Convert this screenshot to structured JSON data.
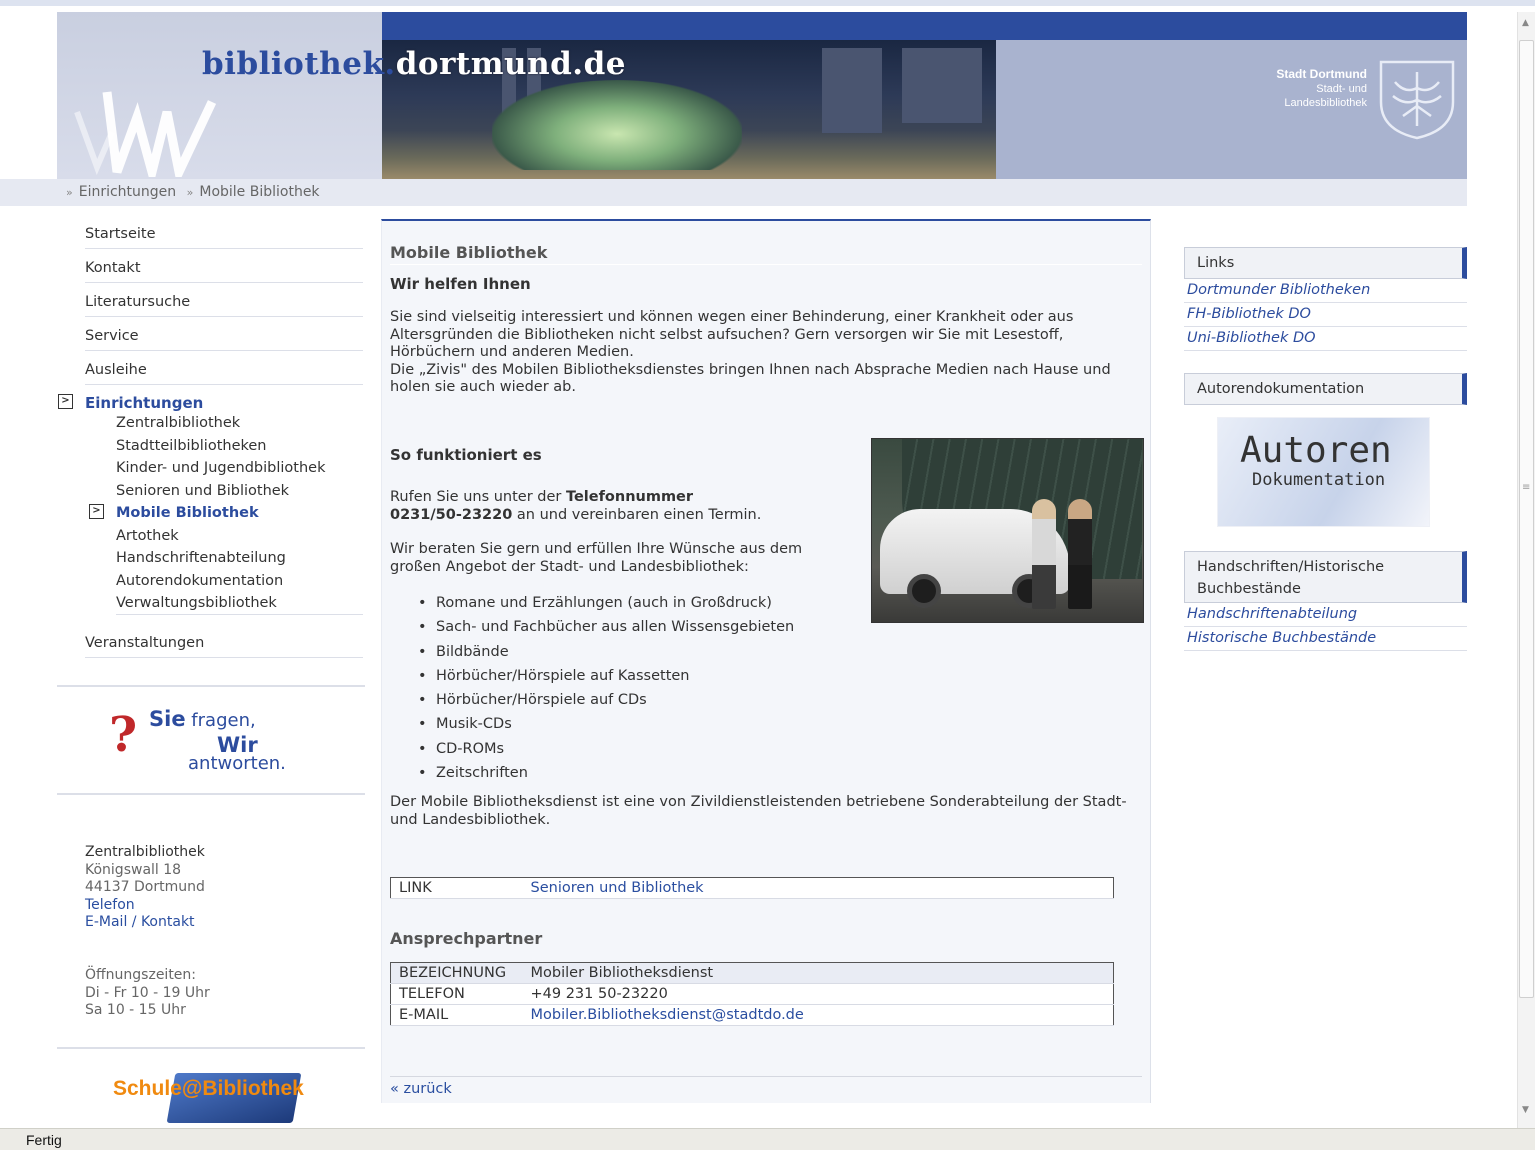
{
  "header": {
    "site_title_blue": "bibliothek.",
    "site_title_white": "dortmund.de",
    "stadt_line1": "Stadt Dortmund",
    "stadt_line2": "Stadt- und",
    "stadt_line3": "Landesbibliothek"
  },
  "breadcrumb": [
    "Einrichtungen",
    "Mobile Bibliothek"
  ],
  "nav": {
    "items": [
      "Startseite",
      "Kontakt",
      "Literatursuche",
      "Service",
      "Ausleihe"
    ],
    "active_section": "Einrichtungen",
    "sub_items": [
      "Zentralbibliothek",
      "Stadtteilbibliotheken",
      "Kinder- und Jugendbibliothek",
      "Senioren und Bibliothek"
    ],
    "active_sub": "Mobile Bibliothek",
    "sub_items_after": [
      "Artothek",
      "Handschriftenabteilung",
      "Autorendokumentation",
      "Verwaltungsbibliothek"
    ],
    "after": "Veranstaltungen"
  },
  "faq": {
    "q": "?",
    "sie": "Sie",
    "fragen": " fragen,",
    "wir": "Wir",
    "antworten": "antworten."
  },
  "address": {
    "name": "Zentralbibliothek",
    "street": "Königswall 18",
    "city": "44137 Dortmund",
    "phone_link": "Telefon",
    "mail_link": "E-Mail / Kontakt"
  },
  "hours": {
    "label": "Öffnungszeiten:",
    "line1": "Di - Fr 10 - 19 Uhr",
    "line2": "Sa 10 - 15 Uhr"
  },
  "school_logo": "Schule@Bibliothek",
  "main": {
    "title": "Mobile Bibliothek",
    "subtitle": "Wir helfen Ihnen",
    "intro1": "Sie sind vielseitig interessiert und können wegen einer Behinderung, einer Krankheit oder aus Altersgründen die Bibliotheken nicht selbst aufsuchen? Gern versorgen wir Sie mit Lesestoff, Hörbüchern und anderen Medien.",
    "intro2": "Die „Zivis\" des Mobilen Bibliotheksdienstes bringen Ihnen nach Absprache Medien nach Hause und holen sie auch wieder ab.",
    "how_title": "So funktioniert es",
    "phone_pre": "Rufen Sie uns unter der ",
    "phone_label": "Telefonnummer",
    "phone_number": "0231/50-23220",
    "phone_post": " an und vereinbaren einen Termin.",
    "offer": "Wir beraten Sie gern und erfüllen Ihre Wünsche aus dem großen Angebot der Stadt- und Landesbibliothek:",
    "list": [
      "Romane und Erzählungen (auch in Großdruck)",
      "Sach- und Fachbücher aus allen Wissensgebieten",
      "Bildbände",
      "Hörbücher/Hörspiele auf Kassetten",
      "Hörbücher/Hörspiele auf CDs",
      "Musik-CDs",
      "CD-ROMs",
      "Zeitschriften"
    ],
    "note": "Der Mobile Bibliotheksdienst ist eine von Zivildienstleistenden betriebene Sonderabteilung der Stadt- und Landesbibliothek.",
    "link_key": "LINK",
    "link_value": "Senioren und Bibliothek",
    "contact_title": "Ansprechpartner",
    "contact": [
      {
        "k": "BEZEICHNUNG",
        "v": "Mobiler Bibliotheksdienst"
      },
      {
        "k": "TELEFON",
        "v": "+49 231  50-23220"
      },
      {
        "k": "E-MAIL",
        "v": "Mobiler.Bibliotheksdienst@stadtdo.de"
      }
    ],
    "back": "« zurück"
  },
  "right": {
    "links_head": "Links",
    "links": [
      "Dortmunder Bibliotheken",
      "FH-Bibliothek DO",
      "Uni-Bibliothek DO"
    ],
    "autoren_head": "Autorendokumentation",
    "autoren_big": "Autoren",
    "autoren_small": "Dokumentation",
    "hand_head": "Handschriften/Historische Buchbestände",
    "hand_links": [
      "Handschriftenabteilung",
      "Historische Buchbestände"
    ]
  },
  "status": "Fertig",
  "colors": {
    "accent": "#2c4c9e",
    "link": "#2a4ea0",
    "question": "#c0282a",
    "school": "#f08a10"
  }
}
